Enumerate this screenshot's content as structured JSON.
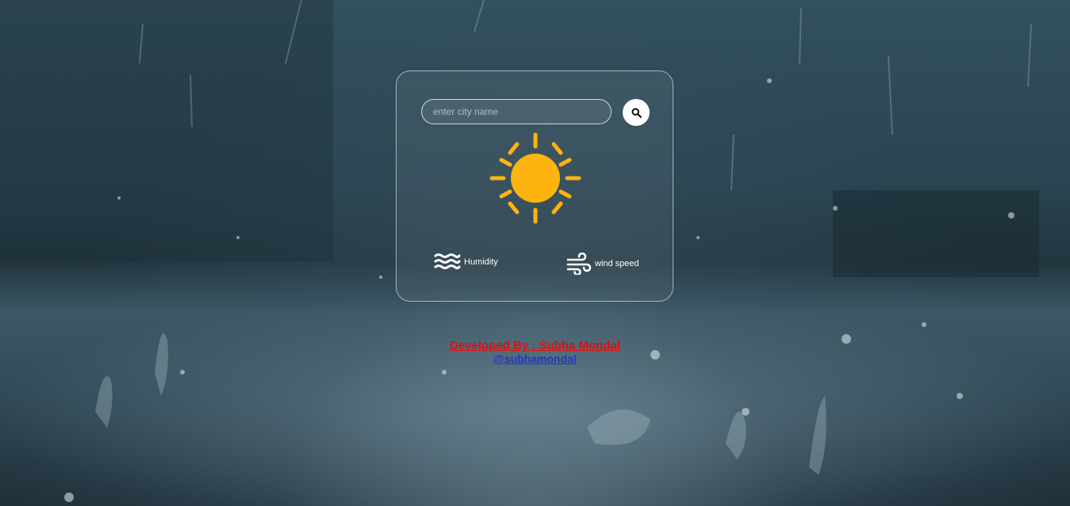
{
  "search": {
    "placeholder": "enter city name",
    "value": ""
  },
  "weather": {
    "icon": "sun-icon",
    "sun_color": "#FDB40F"
  },
  "details": {
    "humidity_label": "Humidity",
    "wind_label": "wind speed"
  },
  "footer": {
    "credit": "Developed By : Subha Mondal",
    "handle": "@subhamondal",
    "credit_color": "#E01010",
    "handle_color": "#2233CC"
  },
  "icons": {
    "search": "search-icon",
    "humidity": "water-waves-icon",
    "wind": "wind-icon"
  }
}
